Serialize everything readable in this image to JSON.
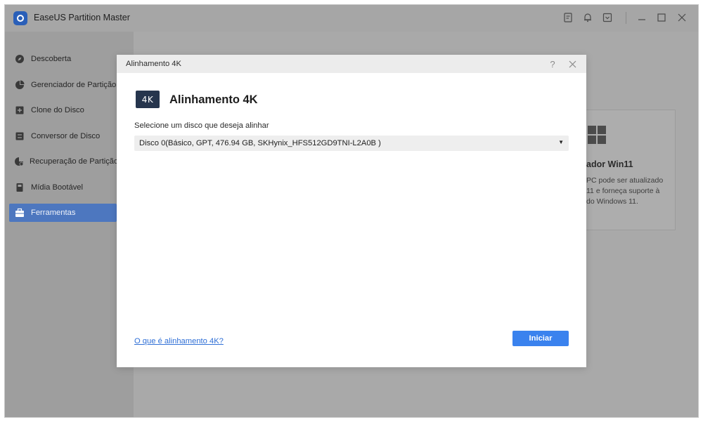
{
  "app": {
    "title": "EaseUS Partition Master"
  },
  "sidebar": {
    "items": [
      {
        "label": "Descoberta",
        "icon": "compass-icon",
        "active": false
      },
      {
        "label": "Gerenciador de Partição",
        "icon": "pie-chart-icon",
        "active": false
      },
      {
        "label": "Clone do Disco",
        "icon": "clone-icon",
        "active": false
      },
      {
        "label": "Conversor de Disco",
        "icon": "convert-icon",
        "active": false
      },
      {
        "label": "Recuperação de Partição",
        "icon": "recovery-icon",
        "active": false
      },
      {
        "label": "Mídia Bootável",
        "icon": "media-icon",
        "active": false
      },
      {
        "label": "Ferramentas",
        "icon": "toolbox-icon",
        "active": true
      }
    ]
  },
  "background": {
    "card": {
      "title": "ador Win11",
      "lines": [
        "PC pode ser atualizado",
        "11 e forneça suporte à",
        "do Windows 11."
      ]
    }
  },
  "dialog": {
    "window_title": "Alinhamento 4K",
    "icon_text": "4K",
    "heading": "Alinhamento 4K",
    "prompt": "Selecione um disco que deseja alinhar",
    "selected_disk": "Disco 0(Básico, GPT, 476.94 GB, SKHynix_HFS512GD9TNI-L2A0B )",
    "help_link": "O que é alinhamento 4K?",
    "start_label": "Iniciar"
  },
  "colors": {
    "accent": "#3a82ee",
    "active_nav": "#4d77bf",
    "link": "#2f6fd6",
    "icon_badge": "#26354d"
  }
}
